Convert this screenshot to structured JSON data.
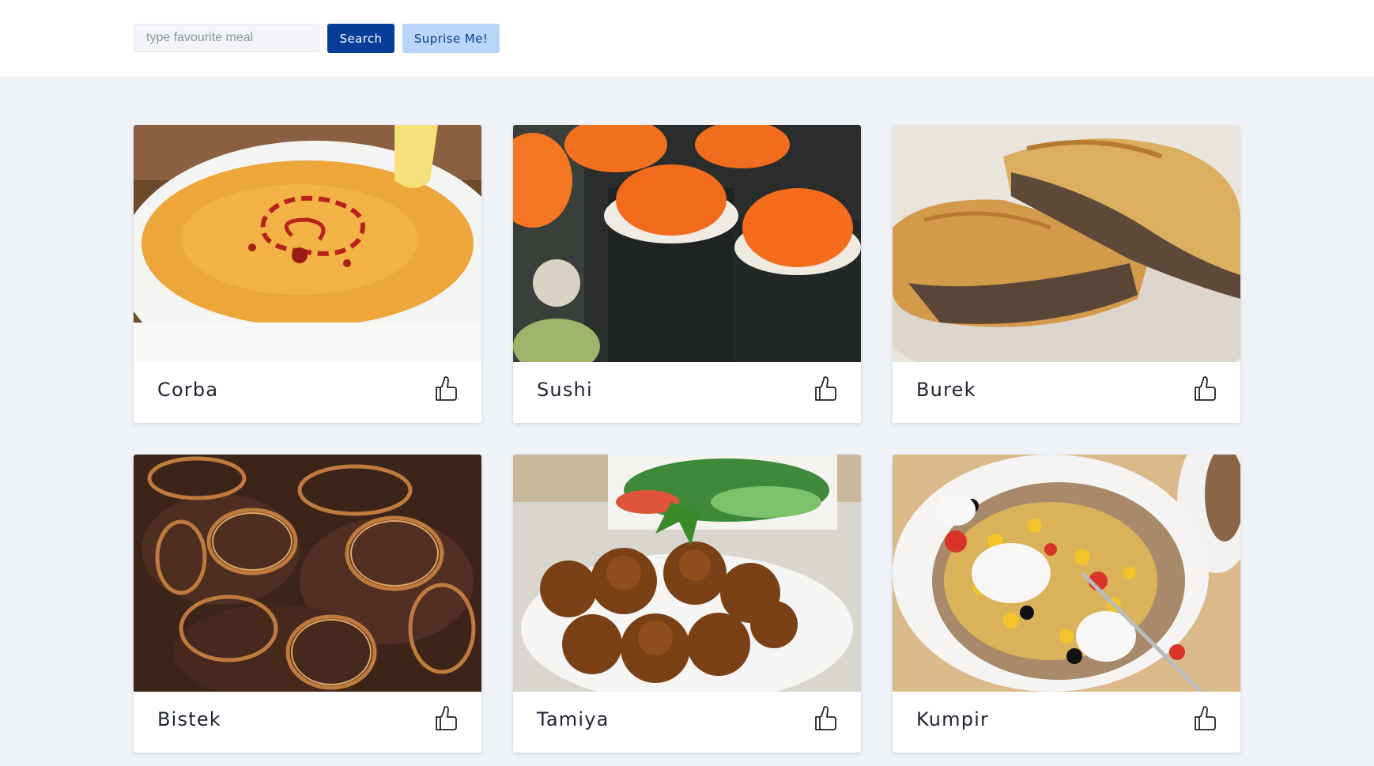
{
  "search": {
    "placeholder": "type favourite meal",
    "value": "",
    "button_label": "Search",
    "surprise_label": "Suprise Me!"
  },
  "meals": [
    {
      "name": "Corba",
      "image": "lentil-soup-photo"
    },
    {
      "name": "Sushi",
      "image": "sushi-rolls-photo"
    },
    {
      "name": "Burek",
      "image": "meat-pastry-photo"
    },
    {
      "name": "Bistek",
      "image": "beef-onions-photo"
    },
    {
      "name": "Tamiya",
      "image": "falafel-photo"
    },
    {
      "name": "Kumpir",
      "image": "stuffed-potato-photo"
    }
  ],
  "icons": {
    "like": "thumbs-up-icon"
  },
  "colors": {
    "primary": "#053d99",
    "secondary": "#b9d5fa",
    "background": "#eff3f8"
  }
}
